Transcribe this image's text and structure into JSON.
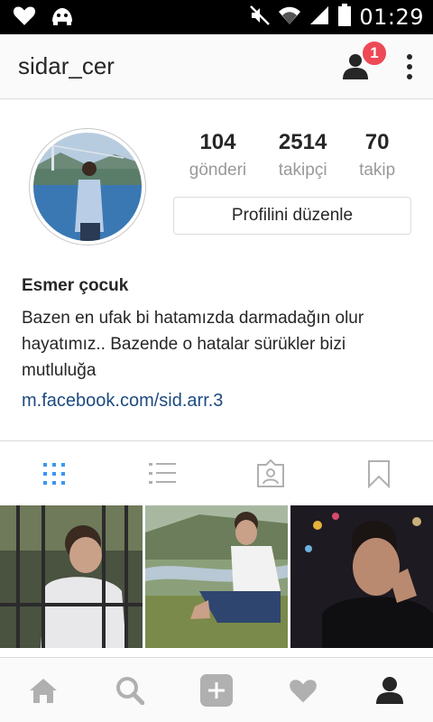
{
  "status_bar": {
    "time": "01:29",
    "icons": [
      "heart-icon",
      "android-icon",
      "mute-icon",
      "wifi-icon",
      "signal-icon",
      "battery-icon"
    ]
  },
  "header": {
    "username": "sidar_cer",
    "notification_count": "1"
  },
  "profile": {
    "stats": [
      {
        "value": "104",
        "label": "gönderi"
      },
      {
        "value": "2514",
        "label": "takipçi"
      },
      {
        "value": "70",
        "label": "takip"
      }
    ],
    "edit_button": "Profilini düzenle",
    "name": "Esmer çocuk",
    "bio": "Bazen en ufak bi hatamızda darmadağın olur hayatımız.. Bazende o hatalar sürükler bizi mutluluğa",
    "link": "m.facebook.com/sid.arr.3"
  },
  "tabs": [
    {
      "icon": "grid-icon",
      "active": true
    },
    {
      "icon": "list-icon",
      "active": false
    },
    {
      "icon": "tagged-icon",
      "active": false
    },
    {
      "icon": "bookmark-icon",
      "active": false
    }
  ],
  "bottom_nav": [
    {
      "icon": "home-icon"
    },
    {
      "icon": "search-icon"
    },
    {
      "icon": "add-icon"
    },
    {
      "icon": "heart-icon"
    },
    {
      "icon": "profile-icon"
    }
  ],
  "colors": {
    "badge": "#ed4956",
    "link": "#1d4a80",
    "active_tab": "#3897f0",
    "muted_icon": "#b0b0b0"
  }
}
